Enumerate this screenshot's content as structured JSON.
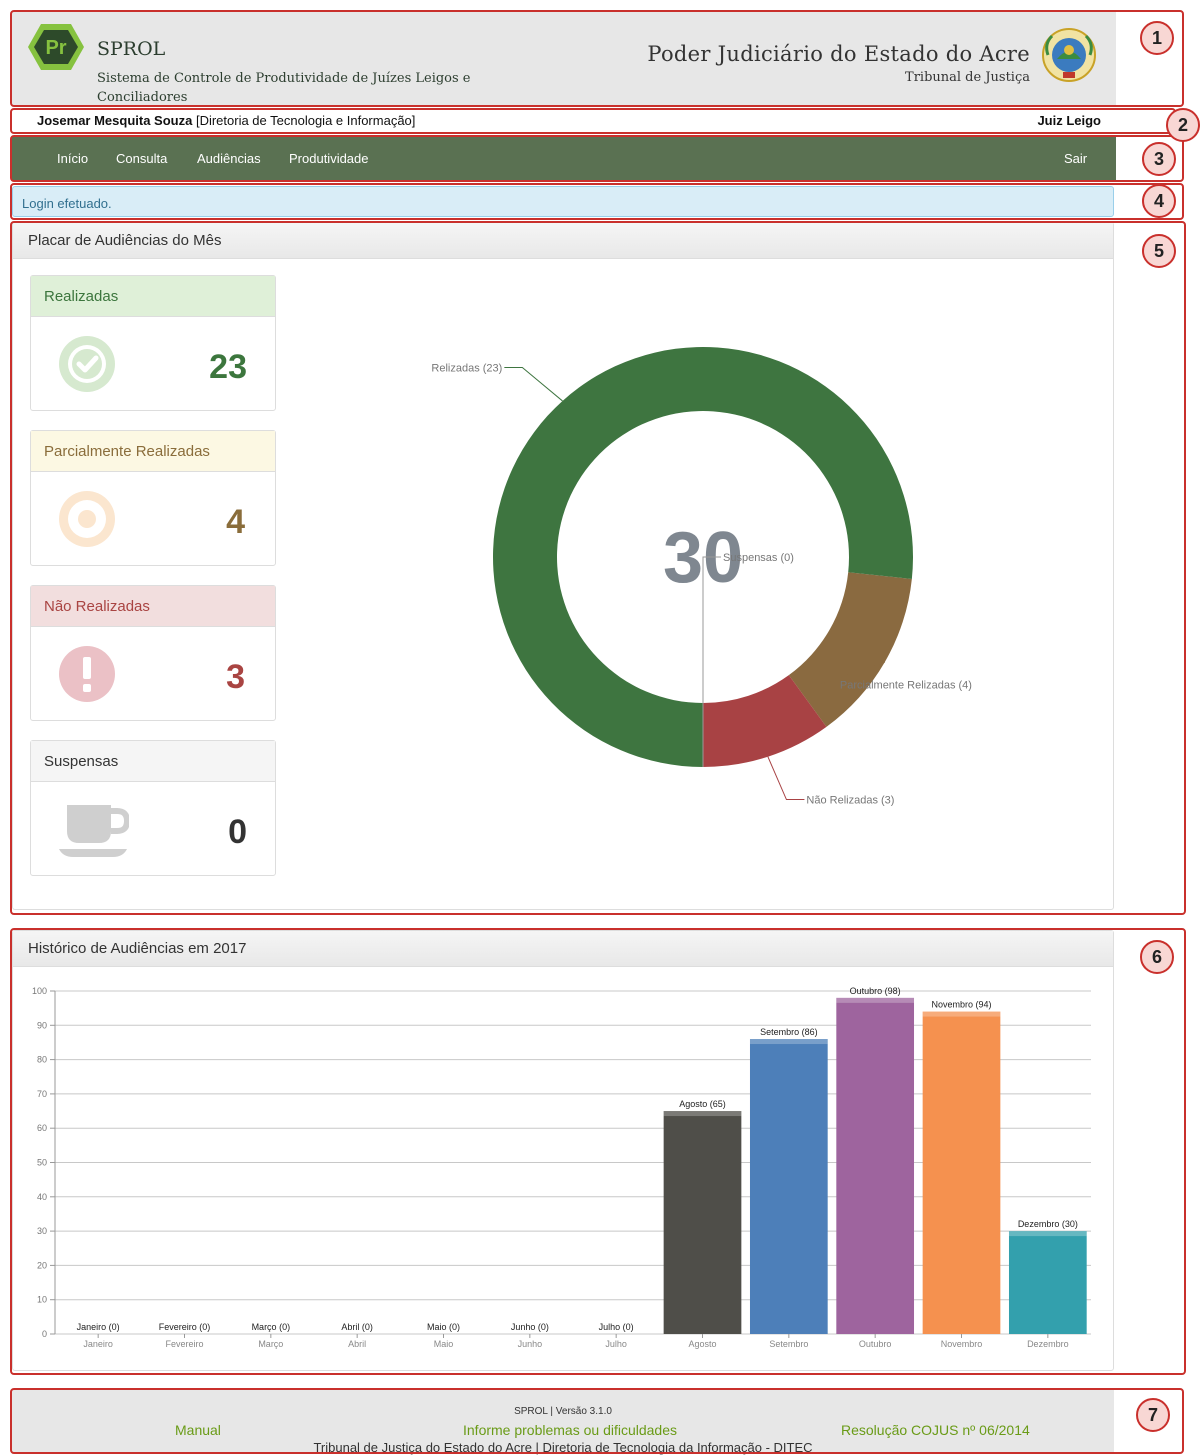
{
  "header": {
    "logo_text": "Pr",
    "app_name": "SPROL",
    "app_subtitle": "Sistema de Controle de Produtividade de Juízes Leigos e Conciliadores",
    "org_name": "Poder Judiciário do Estado do Acre",
    "org_subtitle": "Tribunal de Justiça"
  },
  "user": {
    "name": "Josemar Mesquita Souza",
    "department": "[Diretoria de Tecnologia e Informação]",
    "role": "Juiz Leigo"
  },
  "nav": {
    "items": [
      "Início",
      "Consulta",
      "Audiências",
      "Produtividade"
    ],
    "logout": "Sair"
  },
  "alert": {
    "text": "Login efetuado."
  },
  "placar": {
    "title": "Placar de Audiências do Mês",
    "total": "30",
    "cards": [
      {
        "label": "Realizadas",
        "value": "23",
        "color": "#3c763d",
        "head_bg": "#dff0d8",
        "icon": "check-circle-icon"
      },
      {
        "label": "Parcialmente Realizadas",
        "value": "4",
        "color": "#8a6d3b",
        "head_bg": "#fcf8e3",
        "icon": "bullseye-icon"
      },
      {
        "label": "Não Realizadas",
        "value": "3",
        "color": "#a94442",
        "head_bg": "#f2dede",
        "icon": "exclamation-circle-icon"
      },
      {
        "label": "Suspensas",
        "value": "0",
        "color": "#333333",
        "head_bg": "#f5f5f5",
        "icon": "coffee-cup-icon"
      }
    ]
  },
  "historico": {
    "title": "Histórico de Audiências em 2017"
  },
  "chart_data": [
    {
      "type": "pie",
      "labels": [
        "Relizadas (23)",
        "Parcialmente Relizadas (4)",
        "Não Relizadas (3)",
        "Suspensas (0)"
      ],
      "values": [
        23,
        4,
        3,
        0
      ],
      "colors": [
        "#3e7540",
        "#8a6a40",
        "#a84244",
        "#999999"
      ],
      "center_label": "30"
    },
    {
      "type": "bar",
      "title": "Histórico de Audiências em 2017",
      "categories": [
        "Janeiro",
        "Fevereiro",
        "Março",
        "Abril",
        "Maio",
        "Junho",
        "Julho",
        "Agosto",
        "Setembro",
        "Outubro",
        "Novembro",
        "Dezembro"
      ],
      "values": [
        0,
        0,
        0,
        0,
        0,
        0,
        0,
        65,
        86,
        98,
        94,
        30
      ],
      "data_labels": [
        "Janeiro (0)",
        "Fevereiro (0)",
        "Março (0)",
        "Abril (0)",
        "Maio (0)",
        "Junho (0)",
        "Julho (0)",
        "Agosto (65)",
        "Setembro (86)",
        "Outubro (98)",
        "Novembro (94)",
        "Dezembro (30)"
      ],
      "colors": [
        "#aaaaaa",
        "#aaaaaa",
        "#aaaaaa",
        "#aaaaaa",
        "#aaaaaa",
        "#aaaaaa",
        "#aaaaaa",
        "#4f4e49",
        "#4d7fb9",
        "#9e649e",
        "#f5914f",
        "#33a0ad"
      ],
      "ylim": [
        0,
        100
      ],
      "yticks": [
        0,
        10,
        20,
        30,
        40,
        50,
        60,
        70,
        80,
        90,
        100
      ],
      "grid": true
    }
  ],
  "footer": {
    "version": "SPROL | Versão 3.1.0",
    "manual": "Manual",
    "report": "Informe problemas ou dificuldades",
    "resolution": "Resolução COJUS nº 06/2014",
    "credits": "Tribunal de Justiça do Estado do Acre | Diretoria de Tecnologia da Informação - DITEC"
  },
  "annotations": [
    "1",
    "2",
    "3",
    "4",
    "5",
    "6",
    "7"
  ]
}
